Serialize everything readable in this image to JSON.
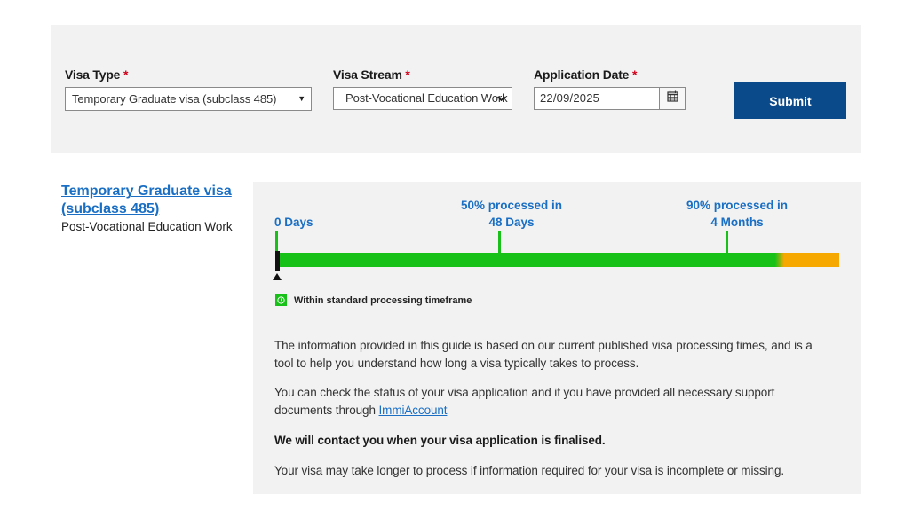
{
  "form": {
    "visa_type": {
      "label": "Visa Type",
      "required_mark": "*",
      "value": "Temporary Graduate visa (subclass 485)"
    },
    "visa_stream": {
      "label": "Visa Stream",
      "required_mark": "*",
      "value": "Post-Vocational Education Work"
    },
    "application_date": {
      "label": "Application Date",
      "required_mark": "*",
      "value": "22/09/2025"
    },
    "submit_label": "Submit"
  },
  "result": {
    "visa_title": "Temporary Graduate visa (subclass 485)",
    "visa_stream": "Post-Vocational Education Work",
    "timeline": {
      "start_label": "0 Days",
      "p50_line1": "50% processed in",
      "p50_line2": "48 Days",
      "p90_line1": "90% processed in",
      "p90_line2": "4 Months"
    },
    "legend_text": "Within standard processing timeframe",
    "info": {
      "p1": "The information provided in this guide is based on our current published visa processing times, and is a tool to help you understand how long a visa typically takes to process.",
      "p2_prefix": "You can check the status of your visa application and if you have provided all necessary support documents through ",
      "p2_link": "ImmiAccount",
      "p3": "We will contact you when your visa application is finalised.",
      "p4": "Your visa may take longer to process if information required for your visa is incomplete or missing."
    }
  },
  "colors": {
    "accent_blue": "#1a6fc4",
    "button_navy": "#0a4a8a",
    "status_green": "#18c118",
    "status_orange": "#f7a800",
    "required_red": "#d0021b"
  },
  "icons": {
    "select_arrow": "triangle-down-icon",
    "stream_arrow": "chevron-down-icon",
    "calendar": "calendar-icon",
    "legend": "clock-icon",
    "marker": "pointer-arrow-icon"
  }
}
